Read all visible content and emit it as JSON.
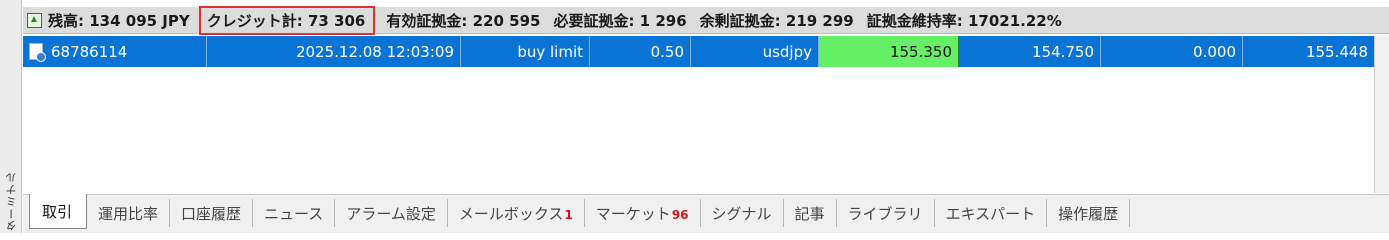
{
  "side_panel": {
    "label": "ターミナル"
  },
  "summary": {
    "balance": "残高: 134 095 JPY",
    "credit": "クレジット計: 73 306",
    "equity": "有効証拠金: 220 595",
    "margin": "必要証拠金: 1 296",
    "free_margin": "余剰証拠金: 219 299",
    "margin_level": "証拠金維持率: 17021.22%"
  },
  "order": {
    "ticket": "68786114",
    "time": "2025.12.08 12:03:09",
    "type": "buy limit",
    "volume": "0.50",
    "symbol": "usdjpy",
    "price": "155.350",
    "sl": "154.750",
    "tp": "0.000",
    "current_price": "155.448"
  },
  "tabs": [
    {
      "label": "取引",
      "active": true
    },
    {
      "label": "運用比率"
    },
    {
      "label": "口座履歴"
    },
    {
      "label": "ニュース"
    },
    {
      "label": "アラーム設定"
    },
    {
      "label": "メールボックス",
      "badge": "1"
    },
    {
      "label": "マーケット",
      "badge": "96"
    },
    {
      "label": "シグナル"
    },
    {
      "label": "記事"
    },
    {
      "label": "ライブラリ"
    },
    {
      "label": "エキスパート"
    },
    {
      "label": "操作履歴"
    }
  ],
  "colors": {
    "row_selected": "#0a74d6",
    "price_highlight": "#66f066",
    "credit_outline": "#e03030",
    "badge": "#d4141b"
  }
}
